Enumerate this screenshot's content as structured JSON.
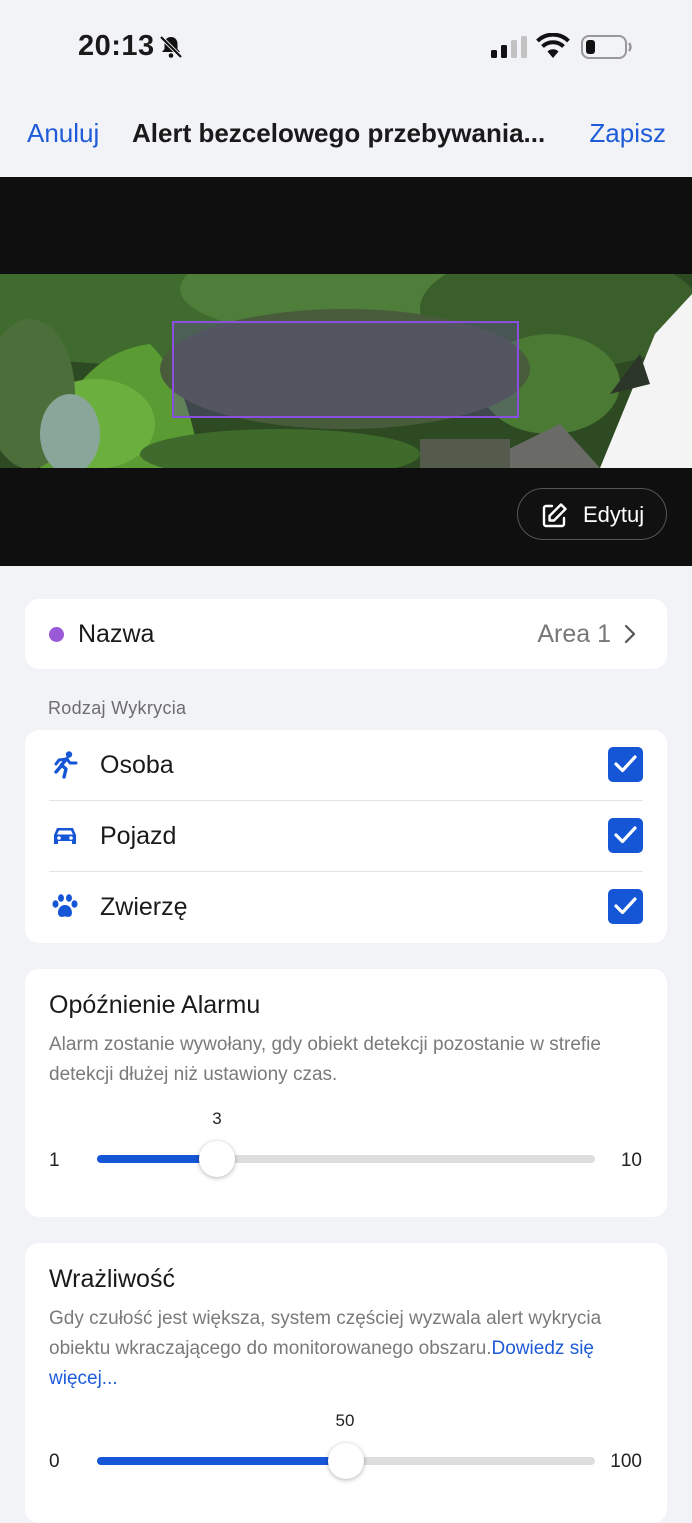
{
  "status_bar": {
    "time": "20:13",
    "icons": [
      "bell-slash-icon",
      "signal-icon",
      "wifi-icon",
      "battery-icon"
    ]
  },
  "nav": {
    "cancel_label": "Anuluj",
    "title": "Alert bezcelowego przebywania...",
    "save_label": "Zapisz"
  },
  "camera": {
    "edit_label": "Edytuj",
    "zone_color": "#8a4fe0"
  },
  "zone_name": {
    "label": "Nazwa",
    "value": "Area 1",
    "dot_color": "#9a5ad8"
  },
  "detection_type": {
    "section_label": "Rodzaj Wykrycia",
    "items": [
      {
        "label": "Osoba",
        "icon": "person-running-icon",
        "checked": true
      },
      {
        "label": "Pojazd",
        "icon": "car-icon",
        "checked": true
      },
      {
        "label": "Zwierzę",
        "icon": "paw-icon",
        "checked": true
      }
    ]
  },
  "alarm_delay": {
    "title": "Opóźnienie Alarmu",
    "description": "Alarm zostanie wywołany, gdy obiekt detekcji pozostanie w strefie detekcji dłużej niż ustawiony czas.",
    "min": "1",
    "max": "10",
    "value": "3"
  },
  "sensitivity": {
    "title": "Wrażliwość",
    "description": "Gdy czułość jest większa, system częściej wyzwala alert wykrycia obiektu wkraczającego do monitorowanego obszaru.",
    "learn_more": "Dowiedz się więcej...",
    "min": "0",
    "max": "100",
    "value": "50"
  },
  "colors": {
    "accent": "#1556d6",
    "link": "#1e5bd8",
    "background": "#f2f3f6"
  }
}
